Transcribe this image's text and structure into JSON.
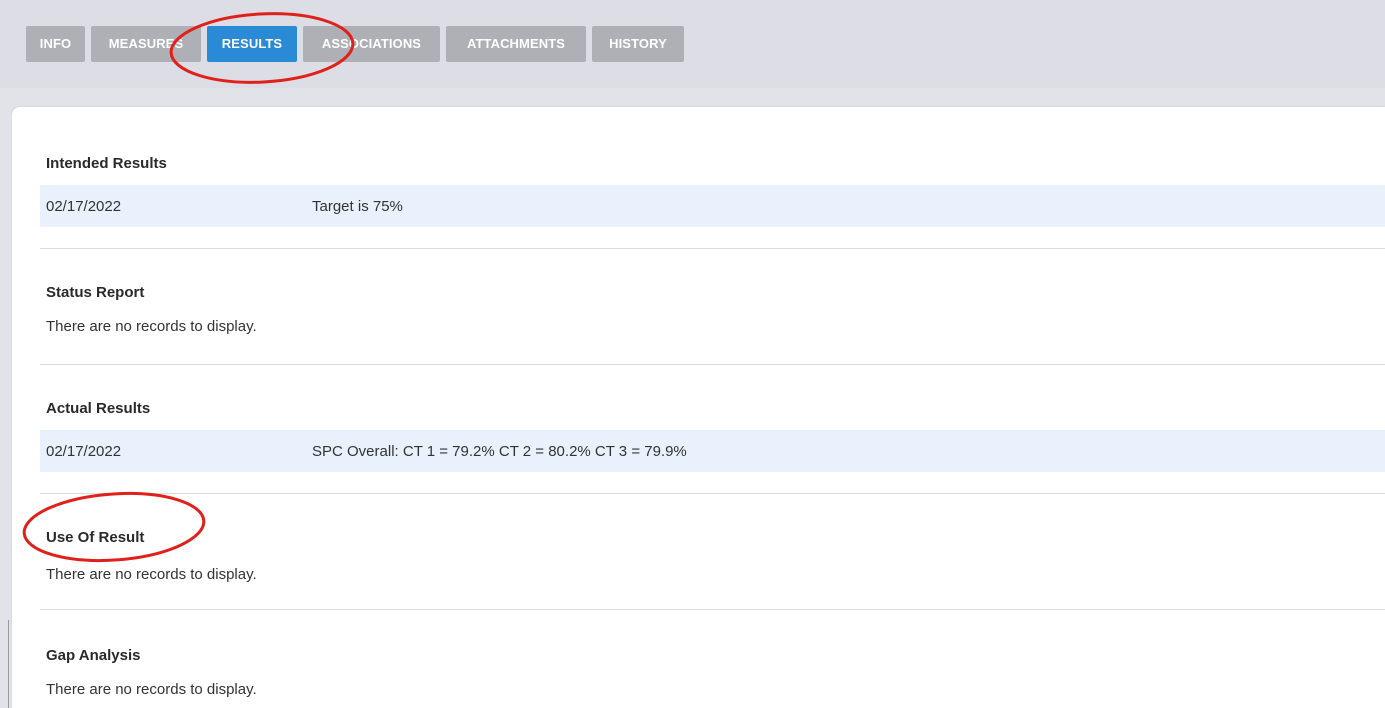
{
  "tabs": [
    {
      "label": "INFO",
      "active": false
    },
    {
      "label": "MEASURES",
      "active": false
    },
    {
      "label": "RESULTS",
      "active": true
    },
    {
      "label": "ASSOCIATIONS",
      "active": false
    },
    {
      "label": "ATTACHMENTS",
      "active": false
    },
    {
      "label": "HISTORY",
      "active": false
    }
  ],
  "sections": {
    "intended": {
      "title": "Intended Results",
      "rows": [
        {
          "date": "02/17/2022",
          "text": "Target is 75%"
        }
      ]
    },
    "status": {
      "title": "Status Report",
      "empty": "There are no records to display."
    },
    "actual": {
      "title": "Actual Results",
      "rows": [
        {
          "date": "02/17/2022",
          "text": "SPC Overall: CT 1 = 79.2% CT 2 = 80.2% CT 3 = 79.9%"
        }
      ]
    },
    "use": {
      "title": "Use Of Result",
      "empty": "There are no records to display."
    },
    "gap": {
      "title": "Gap Analysis",
      "empty": "There are no records to display."
    }
  },
  "colors": {
    "active_tab": "#2a8ad6",
    "inactive_tab": "#aeb0b5",
    "row_highlight": "#e9f1fd",
    "annotation": "#e0201a"
  }
}
